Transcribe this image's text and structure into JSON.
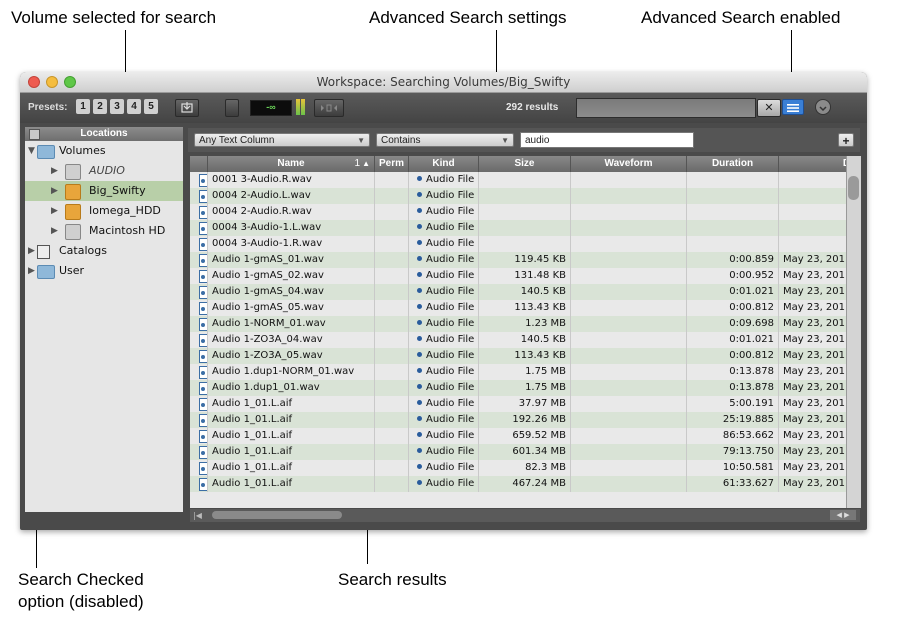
{
  "callouts": {
    "volume_selected": "Volume selected for search",
    "advanced_settings": "Advanced Search settings",
    "advanced_enabled": "Advanced Search enabled",
    "search_checked_line1": "Search Checked",
    "search_checked_line2": "option (disabled)",
    "search_results": "Search results"
  },
  "window": {
    "title": "Workspace: Searching Volumes/Big_Swifty"
  },
  "toolbar": {
    "presets_label": "Presets:",
    "presets": [
      "1",
      "2",
      "3",
      "4",
      "5"
    ],
    "meter_value": "-∞",
    "results_count": "292 results",
    "search_value": "",
    "close_label": "✕"
  },
  "sidebar": {
    "header": "Locations",
    "items": [
      {
        "label": "Volumes"
      },
      {
        "label": "AUDIO"
      },
      {
        "label": "Big_Swifty"
      },
      {
        "label": "Iomega_HDD"
      },
      {
        "label": "Macintosh HD"
      },
      {
        "label": "Catalogs"
      },
      {
        "label": "User"
      }
    ]
  },
  "filter": {
    "column_select": "Any Text Column",
    "operator_select": "Contains",
    "query": "audio",
    "add_label": "+"
  },
  "table": {
    "columns": [
      "Name",
      "1",
      "Perm",
      "Kind",
      "Size",
      "Waveform",
      "Duration",
      "Dat"
    ],
    "sort_indicator": "▲",
    "rows": [
      {
        "name": "0001 3-Audio.R.wav",
        "kind": "Audio File",
        "size": "",
        "duration": "",
        "date": ""
      },
      {
        "name": "0004 2-Audio.L.wav",
        "kind": "Audio File",
        "size": "",
        "duration": "",
        "date": ""
      },
      {
        "name": "0004 2-Audio.R.wav",
        "kind": "Audio File",
        "size": "",
        "duration": "",
        "date": ""
      },
      {
        "name": "0004 3-Audio-1.L.wav",
        "kind": "Audio File",
        "size": "",
        "duration": "",
        "date": ""
      },
      {
        "name": "0004 3-Audio-1.R.wav",
        "kind": "Audio File",
        "size": "",
        "duration": "",
        "date": ""
      },
      {
        "name": "Audio 1-gmAS_01.wav",
        "kind": "Audio File",
        "size": "119.45 KB",
        "duration": "0:00.859",
        "date": "May 23, 201"
      },
      {
        "name": "Audio 1-gmAS_02.wav",
        "kind": "Audio File",
        "size": "131.48 KB",
        "duration": "0:00.952",
        "date": "May 23, 201"
      },
      {
        "name": "Audio 1-gmAS_04.wav",
        "kind": "Audio File",
        "size": "140.5 KB",
        "duration": "0:01.021",
        "date": "May 23, 201"
      },
      {
        "name": "Audio 1-gmAS_05.wav",
        "kind": "Audio File",
        "size": "113.43 KB",
        "duration": "0:00.812",
        "date": "May 23, 201"
      },
      {
        "name": "Audio 1-NORM_01.wav",
        "kind": "Audio File",
        "size": "1.23 MB",
        "duration": "0:09.698",
        "date": "May 23, 201"
      },
      {
        "name": "Audio 1-ZO3A_04.wav",
        "kind": "Audio File",
        "size": "140.5 KB",
        "duration": "0:01.021",
        "date": "May 23, 201"
      },
      {
        "name": "Audio 1-ZO3A_05.wav",
        "kind": "Audio File",
        "size": "113.43 KB",
        "duration": "0:00.812",
        "date": "May 23, 201"
      },
      {
        "name": "Audio 1.dup1-NORM_01.wav",
        "kind": "Audio File",
        "size": "1.75 MB",
        "duration": "0:13.878",
        "date": "May 23, 201"
      },
      {
        "name": "Audio 1.dup1_01.wav",
        "kind": "Audio File",
        "size": "1.75 MB",
        "duration": "0:13.878",
        "date": "May 23, 201"
      },
      {
        "name": "Audio 1_01.L.aif",
        "kind": "Audio File",
        "size": "37.97 MB",
        "duration": "5:00.191",
        "date": "May 23, 201"
      },
      {
        "name": "Audio 1_01.L.aif",
        "kind": "Audio File",
        "size": "192.26 MB",
        "duration": "25:19.885",
        "date": "May 23, 201"
      },
      {
        "name": "Audio 1_01.L.aif",
        "kind": "Audio File",
        "size": "659.52 MB",
        "duration": "86:53.662",
        "date": "May 23, 201"
      },
      {
        "name": "Audio 1_01.L.aif",
        "kind": "Audio File",
        "size": "601.34 MB",
        "duration": "79:13.750",
        "date": "May 23, 201"
      },
      {
        "name": "Audio 1_01.L.aif",
        "kind": "Audio File",
        "size": "82.3 MB",
        "duration": "10:50.581",
        "date": "May 23, 201"
      },
      {
        "name": "Audio 1_01.L.aif",
        "kind": "Audio File",
        "size": "467.24 MB",
        "duration": "61:33.627",
        "date": "May 23, 201"
      }
    ]
  },
  "colors": {
    "row_even": "#e9e9e9",
    "row_odd": "#d9e3d6",
    "selected_row": "#b8cfa8",
    "enabled_blue": "#3a7fd5"
  }
}
